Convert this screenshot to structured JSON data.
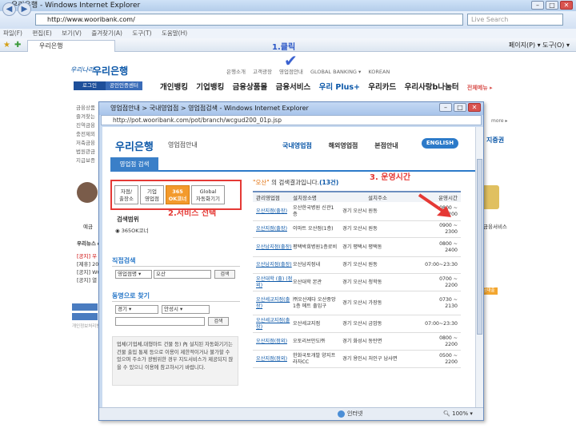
{
  "browser": {
    "title": "우리은행 - Windows Internet Explorer",
    "url": "http://www.wooribank.com/",
    "search_placeholder": "Live Search",
    "menu": [
      "파일(F)",
      "편집(E)",
      "보기(V)",
      "즐겨찾기(A)",
      "도구(T)",
      "도움말(H)"
    ],
    "tab": "우리은행",
    "commands": "페이지(P) ▾   도구(O) ▾"
  },
  "bg": {
    "slogan": "우리나라",
    "logo": "우리은행",
    "util_links": [
      "은행소개",
      "고객광장",
      "영업점안내",
      "GLOBAL BANKING ▾",
      "KOREAN"
    ],
    "login": "로그인",
    "cert": "공인인증센터",
    "gnb": [
      "개인뱅킹",
      "기업뱅킹",
      "금융상품몰",
      "금융서비스",
      "우리 Plus+",
      "우리카드",
      "우리사랑b나눔터"
    ],
    "total_menu": "전체메뉴 ▸",
    "left_lines": [
      "금융상품",
      "즐겨찾는",
      "",
      "진역금융",
      "충전제외",
      "저축금융",
      "법원관금",
      "지급보증"
    ],
    "right_lines": [
      "지증권"
    ],
    "more": "more ▸",
    "icon_left_label": "예금",
    "icon_right_label": "금융서비스",
    "ann_title": "우리뉴스 ▸",
    "ann_lines": [
      "[공지] 우",
      "[제휴] 20",
      "[공지] WC",
      "[공지] 열"
    ],
    "copyright": "개인정보처리방침 COPYRIGHT",
    "small_btn": "금대출"
  },
  "popup": {
    "title": "영업점안내 > 국내영업점 > 영업점검색 - Windows Internet Explorer",
    "url": "http://pot.wooribank.com/pot/branch/wcgud200_01p.jsp",
    "logo": "우리은행",
    "logo_sub": "영업점안내",
    "menu": [
      "국내영업점",
      "해외영업점",
      "본점안내"
    ],
    "english": "ENGLISH",
    "header_tab": "영업점 검색",
    "svc_buttons": [
      "자점/\n출장소",
      "기업\n영업점",
      "365\nOK코너",
      "Global\n자동화기기"
    ],
    "range_label": "검색범위",
    "range_option": "◉ 365OK코너",
    "direct_title": "직접검색",
    "direct_select": "영업점명 ▾",
    "direct_value": "오산",
    "direct_btn": "검색",
    "dong_title": "동명으로 찾기",
    "sido": "경기 ▾",
    "gu": "안성시 ▾",
    "dong_btn": "검색",
    "note": "업체(기업체,대형마트 건물 등) 內 설치된 자동화기기는 건물 출입 통제 등으로 이용이 제한적이거나 불가할 수 있으며 주소가 광범위한 경우 지도서비스가 제공되지 않을 수 있으니 이용에 참고하시기 바랍니다.",
    "result_prefix": "\"오산\"",
    "result_mid": " 의 검색결과입니다.",
    "result_count": "(13건)",
    "table_headers": [
      "관리영업점",
      "설치장소명",
      "설치주소",
      "운영시간"
    ],
    "rows": [
      {
        "branch": "오산지점(출장)",
        "place": "오산한국병원 신관1층",
        "addr": "경기 오산시 원동",
        "hours": "0800 ~\n2200"
      },
      {
        "branch": "오산지점(출장)",
        "place": "이마트 오산점(1층)",
        "addr": "경기 오산시 원동",
        "hours": "0900 ~\n2300"
      },
      {
        "branch": "오산남지점(출장)",
        "place": "평택박희병원1층로비",
        "addr": "경기 평택시 평택동",
        "hours": "0800 ~\n2400"
      },
      {
        "branch": "오산남지점(출장)",
        "place": "오산남지점내",
        "addr": "경기 오산시 원동",
        "hours": "07:00~23:30"
      },
      {
        "branch": "오산대학 (출) (점외)",
        "place": "오산대학 본관",
        "addr": "경기 오산시 청학동",
        "hours": "0700 ~\n2200"
      },
      {
        "branch": "오산세교지점(출장)",
        "place": "㈜오산제다 오산중앙 1층 메트 출입구",
        "addr": "경기 오산시 가장동",
        "hours": "0730 ~\n2130"
      },
      {
        "branch": "오산세교지점(출장)",
        "place": "오산세교지점",
        "addr": "경기 오산시 금암동",
        "hours": "07:00~23:30"
      },
      {
        "branch": "오산지점(점외)",
        "place": "오토리브만도㈜",
        "addr": "경기 화성시 동탄면",
        "hours": "0800 ~\n2200"
      },
      {
        "branch": "오산지점(점외)",
        "place": "한화국토개발 양지프라자CC",
        "addr": "경기 용인시 처인구 남사면",
        "hours": "0500 ~\n2200"
      }
    ],
    "status_text": "인터넷",
    "zoom": "100%"
  },
  "annotations": {
    "step1": "1.클릭",
    "step2": "2.서비스 선택",
    "step3": "3. 운영시간"
  },
  "colors": {
    "brand_blue": "#0b57a8",
    "highlight_red": "#e53935",
    "selected_orange": "#f39a2c"
  }
}
